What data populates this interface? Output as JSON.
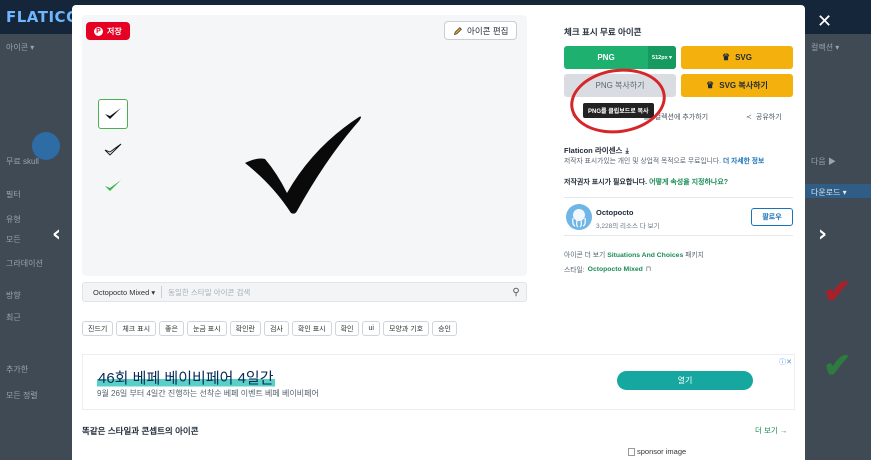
{
  "background": {
    "logo_text": "FLATICON",
    "left_items": [
      "아이콘 ▾",
      "무료 skull",
      "필터",
      "유형",
      "모든",
      "그라데이션",
      "방향",
      "최근",
      "추가한",
      "모든 정렬"
    ],
    "right_items": [
      "컬렉션 ▾",
      "다음 ▶",
      "다운로드 ▾"
    ]
  },
  "modal": {
    "save_label": "저장",
    "edit_label": "아이콘 편집",
    "style_selector": "Octopocto Mixed ▾",
    "search_placeholder": "동일한 스타일 아이콘 검색",
    "tags": [
      "진드기",
      "체크 표시",
      "좋은",
      "눈금 표시",
      "확인란",
      "검사",
      "확인 표시",
      "확인",
      "ui",
      "모양과 기호",
      "승인"
    ],
    "icon_title": "체크 표시 무료 아이콘",
    "png_label": "PNG",
    "png_size": "512px ▾",
    "svg_label": "SVG",
    "copy_png_label": "PNG 복사하기",
    "copy_svg_label": "SVG 복사하기",
    "tooltip": "PNG를 클립보드로 복사",
    "add_collection": "컬렉션에 추가하기",
    "share": "공유하기",
    "license_title": "Flaticon 라이센스",
    "license_desc": "저작자 표시가있는 개인 및 상업적 목적으로 무료입니다.",
    "license_more": "더 자세한 정보",
    "attribution_label": "저작권자 표시가 필요합니다.",
    "attribution_link": "어떻게 속성을 지정하나요?",
    "author_name": "Octopocto",
    "author_count": "3,228의 리소스 다 보기",
    "follow_label": "팔로우",
    "pack_prefix": "아이콘 더 보기",
    "pack_name": "Situations And Choices",
    "pack_suffix": "패키지",
    "style_prefix": "스타일:",
    "style_name": "Octopocto Mixed",
    "ad_title": "46회 베페 베이비페어 4일간",
    "ad_sub": "9월 26일 부터 4일간 진행하는 선착순 베페 이벤트 베페 베이비페어",
    "ad_button": "열기",
    "similar_title": "똑같은 스타일과 콘셉트의 아이콘",
    "more_label": "더 보기 →",
    "sponsor_label": "sponsor image"
  },
  "colors": {
    "png_green": "#1db06f",
    "svg_yellow": "#f4b10d",
    "save_red": "#e60023",
    "annotation_red": "#d7262a"
  },
  "icons": [
    "pinterest-icon",
    "edit-pencil-icon",
    "search-icon",
    "crown-icon",
    "plus-icon",
    "collection-icon",
    "share-icon",
    "download-icon",
    "bookmark-icon",
    "close-icon",
    "arrow-left-icon",
    "arrow-right-icon"
  ]
}
